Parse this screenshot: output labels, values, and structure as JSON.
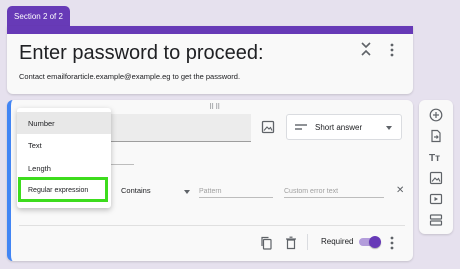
{
  "section_tab": "Section 2 of 2",
  "header": {
    "title": "Enter password to proceed:",
    "description": "Contact emailforarticle.example@example.eg to get the password."
  },
  "question": {
    "type_label": "Short answer",
    "validation": {
      "condition": "Contains",
      "pattern_placeholder": "Pattern",
      "error_placeholder": "Custom error text"
    },
    "required_label": "Required",
    "required_on": true
  },
  "dropdown": {
    "items": [
      "Number",
      "Text",
      "Length",
      "Regular expression"
    ],
    "active": "Number",
    "highlighted": "Regular expression"
  },
  "sidebar": {
    "icons": [
      "add-question-icon",
      "import-questions-icon",
      "add-title-icon",
      "add-image-icon",
      "add-video-icon",
      "add-section-icon"
    ]
  },
  "colors": {
    "accent": "#673ab7",
    "focus_border": "#4285f4",
    "highlight": "#3ddc1d",
    "background": "#e6e1ee"
  }
}
